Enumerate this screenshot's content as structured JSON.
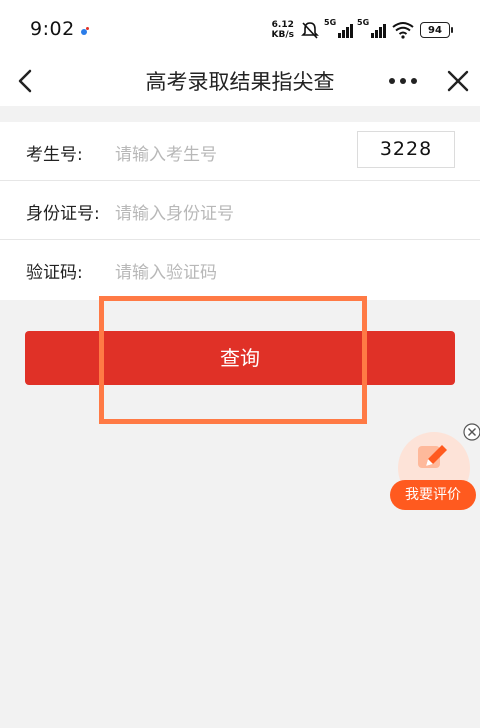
{
  "status_bar": {
    "time": "9:02",
    "net_speed_value": "6.12",
    "net_speed_unit": "KB/s",
    "signal1_tag": "5G",
    "signal2_tag": "5G",
    "battery": "94"
  },
  "nav": {
    "title": "高考录取结果指尖查"
  },
  "form": {
    "exam_no_label": "考生号:",
    "exam_no_placeholder": "请输入考生号",
    "id_label": "身份证号:",
    "id_placeholder": "请输入身份证号",
    "captcha_label": "验证码:",
    "captcha_placeholder": "请输入验证码",
    "captcha_code": "3228"
  },
  "query_button": "查询",
  "review_button": "我要评价",
  "colors": {
    "primary": "#e03127",
    "highlight": "#ff7a45",
    "review": "#ff5a1f"
  }
}
